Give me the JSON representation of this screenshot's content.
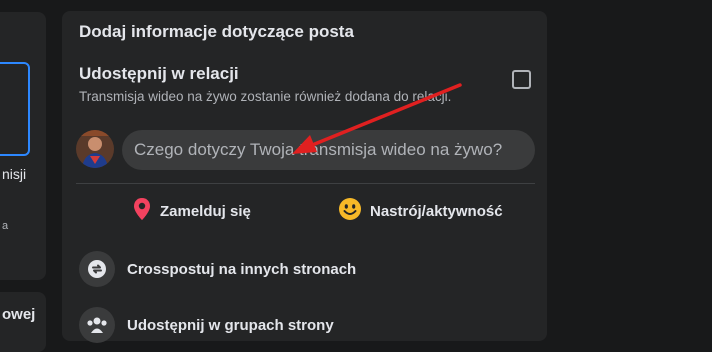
{
  "left": {
    "text1": "nisji",
    "text2": "a",
    "text3": "owej"
  },
  "panel": {
    "title": "Dodaj informacje dotyczące posta",
    "share_story_title": "Udostępnij w relacji",
    "share_story_desc": "Transmisja wideo na żywo zostanie również dodana do relacji.",
    "share_story_checked": false,
    "post_input_placeholder": "Czego dotyczy Twoja transmisja wideo na żywo?",
    "actions": {
      "check_in": "Zamelduj się",
      "feeling": "Nastrój/aktywność"
    },
    "crosspost_label": "Crosspostuj na innych stronach",
    "groups_label": "Udostępnij w grupach strony"
  },
  "icons": {
    "check_in": "location-pin-icon",
    "feeling": "smiley-icon",
    "crosspost": "crosspost-arrows-icon",
    "groups": "groups-icon"
  },
  "colors": {
    "background": "#18191a",
    "card": "#242526",
    "input": "#3a3b3c",
    "accent_blue": "#2d88ff",
    "pin_red": "#f3425f",
    "smiley_yellow": "#f7b928",
    "annotation_arrow": "#e02020"
  }
}
